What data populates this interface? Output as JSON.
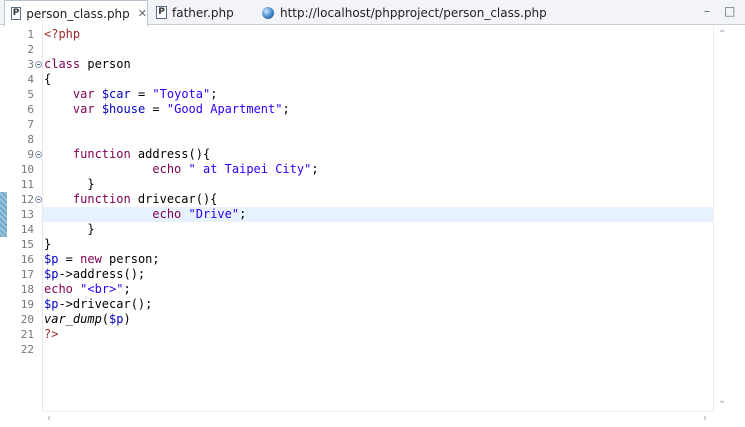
{
  "tabs": [
    {
      "label": "person_class.php",
      "active": true,
      "icon": "php-file-icon",
      "closable": true
    },
    {
      "label": "father.php",
      "active": false,
      "icon": "php-file-icon"
    },
    {
      "label": "http://localhost/phpproject/person_class.php",
      "active": false,
      "icon": "globe-icon"
    }
  ],
  "window_controls": {
    "minimize": "–",
    "maximize": "□"
  },
  "file_icon_letter": "P",
  "close_glyph": "✕",
  "editor": {
    "current_line": 13,
    "lines": [
      {
        "n": "1",
        "code": "<?php"
      },
      {
        "n": "2",
        "code": ""
      },
      {
        "n": "3",
        "code": "class person"
      },
      {
        "n": "4",
        "code": "{"
      },
      {
        "n": "5",
        "code": "    var $car = \"Toyota\";"
      },
      {
        "n": "6",
        "code": "    var $house = \"Good Apartment\";"
      },
      {
        "n": "7",
        "code": ""
      },
      {
        "n": "8",
        "code": ""
      },
      {
        "n": "9",
        "code": "    function address(){"
      },
      {
        "n": "10",
        "code": "               echo \" at Taipei City\";"
      },
      {
        "n": "11",
        "code": "      }"
      },
      {
        "n": "12",
        "code": "    function drivecar(){"
      },
      {
        "n": "13",
        "code": "               echo \"Drive\";"
      },
      {
        "n": "14",
        "code": "      }"
      },
      {
        "n": "15",
        "code": "}"
      },
      {
        "n": "16",
        "code": "$p = new person;"
      },
      {
        "n": "17",
        "code": "$p->address();"
      },
      {
        "n": "18",
        "code": "echo \"<br>\";"
      },
      {
        "n": "19",
        "code": "$p->drivecar();"
      },
      {
        "n": "20",
        "code": "var_dump($p)"
      },
      {
        "n": "21",
        "code": "?>"
      },
      {
        "n": "22",
        "code": ""
      }
    ],
    "fold_lines": [
      3,
      9,
      12
    ],
    "marked_lines": [
      12,
      13,
      14
    ]
  },
  "colors": {
    "keyword": "#7f0055",
    "variable": "#0000c0",
    "string": "#2a00ff",
    "php_tag": "#9c2b2b",
    "current_line": "#e8f2fe"
  }
}
